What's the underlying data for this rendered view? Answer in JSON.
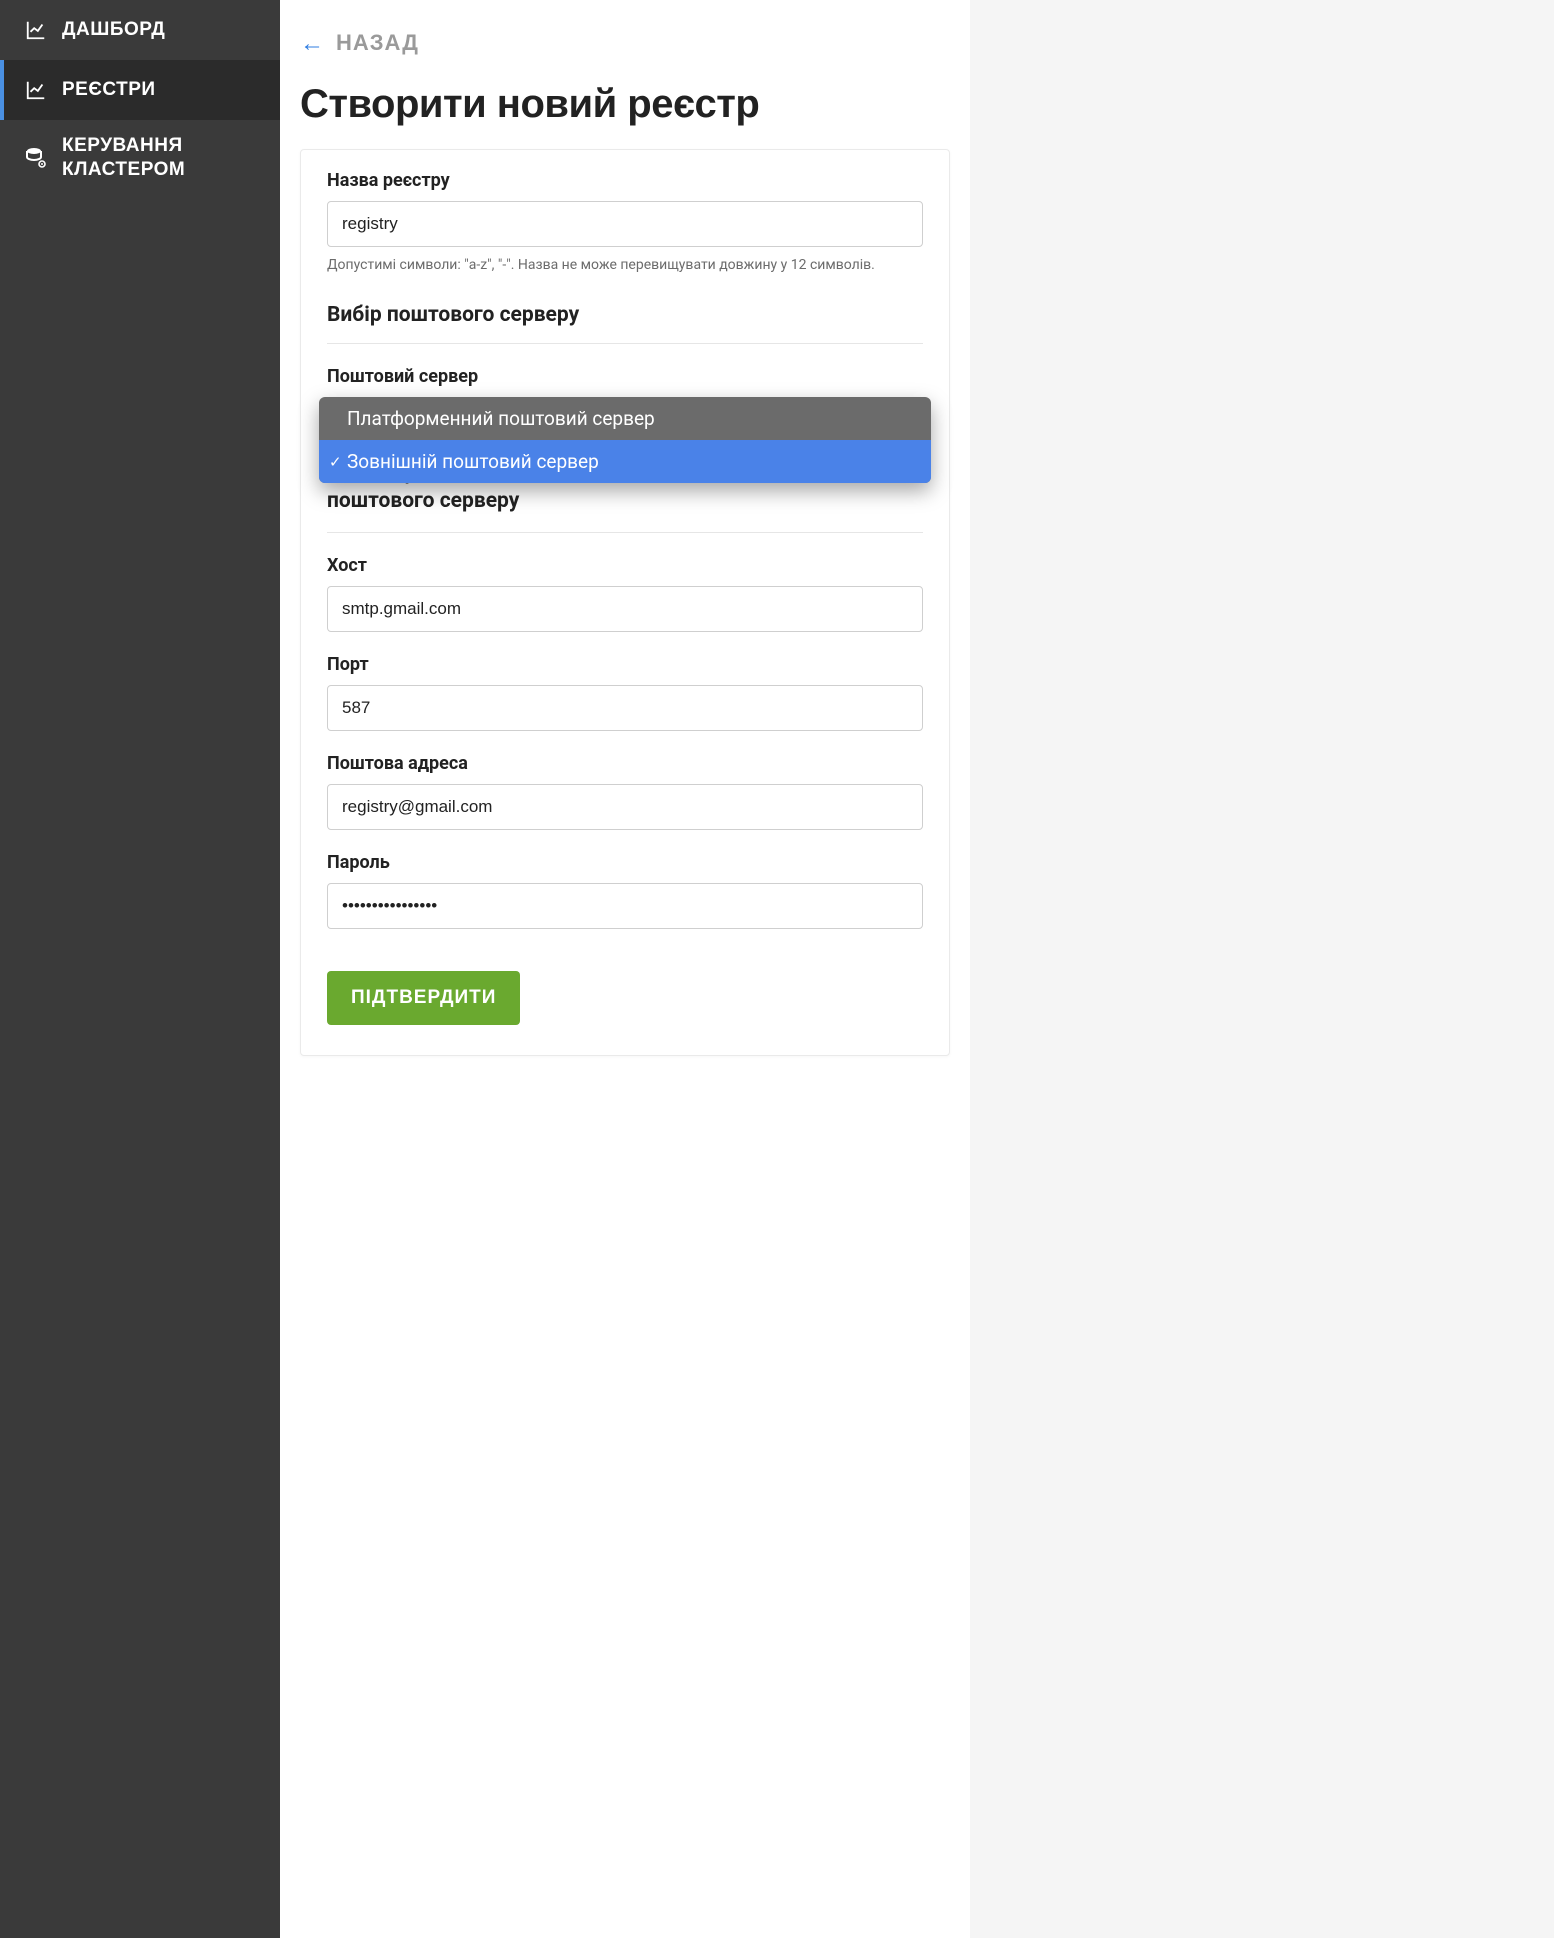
{
  "sidebar": {
    "items": [
      {
        "label": "ДАШБОРД"
      },
      {
        "label": "РЕЄСТРИ"
      },
      {
        "label_line1": "КЕРУВАННЯ",
        "label_line2": "КЛАСТЕРОМ"
      }
    ]
  },
  "back": {
    "label": "НАЗАД"
  },
  "page": {
    "title": "Створити новий реєстр"
  },
  "registry_name": {
    "label": "Назва реєстру",
    "value": "registry",
    "hint": "Допустимі символи: \"a-z\", \"-\". Назва не може перевищувати довжину у 12 символів."
  },
  "mail_server_choice": {
    "heading": "Вибір поштового серверу",
    "label": "Поштовий сервер",
    "options": [
      "Платформенний поштовий сервер",
      "Зовнішній поштовий сервер"
    ],
    "selected": "Зовнішній поштовий сервер"
  },
  "smtp": {
    "heading": "Налаштування SMTP-підключення до зовнішнього поштового серверу",
    "host": {
      "label": "Хост",
      "value": "smtp.gmail.com"
    },
    "port": {
      "label": "Порт",
      "value": "587"
    },
    "email": {
      "label": "Поштова адреса",
      "value": "registry@gmail.com"
    },
    "password": {
      "label": "Пароль",
      "value": "••••••••••••••••"
    }
  },
  "submit": {
    "label": "ПІДТВЕРДИТИ"
  }
}
